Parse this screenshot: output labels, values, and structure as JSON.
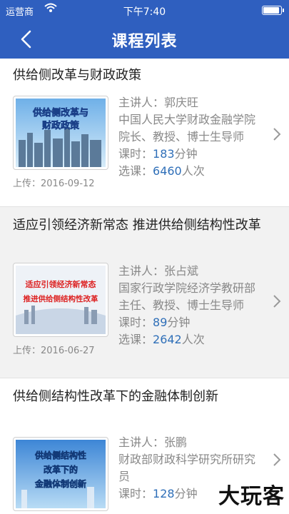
{
  "status_bar": {
    "carrier": "运营商",
    "time": "下午7:40"
  },
  "nav": {
    "title": "课程列表"
  },
  "courses": [
    {
      "title": "供给侧改革与财政政策",
      "thumb_lines": [
        "供给侧改革与",
        "财政政策"
      ],
      "upload": "上传：2016-09-12",
      "speaker_label": "主讲人：",
      "speaker": "郭庆旺",
      "bio": "中国人民大学财政金融学院院长、教授、博士生导师",
      "duration_label": "课时：",
      "duration": "183",
      "duration_unit": "分钟",
      "views_label": "选课：",
      "views": "6460",
      "views_unit": "人次"
    },
    {
      "title": "适应引领经济新常态 推进供给侧结构性改革",
      "thumb_lines": [
        "适应引领经济新常态",
        "推进供给侧结构性改革"
      ],
      "upload": "上传：2016-06-27",
      "speaker_label": "主讲人：",
      "speaker": "张占斌",
      "bio": "国家行政学院经济学教研部主任、教授、博士生导师",
      "duration_label": "课时：",
      "duration": "89",
      "duration_unit": "分钟",
      "views_label": "选课：",
      "views": "2642",
      "views_unit": "人次"
    },
    {
      "title": "供给侧结构性改革下的金融体制创新",
      "thumb_lines": [
        "供给侧结构性",
        "改革下的",
        "金融体制创新"
      ],
      "speaker_label": "主讲人：",
      "speaker": "张鹏",
      "bio": "财政部财政科学研究所研究员",
      "duration_label": "课时：",
      "duration": "128",
      "duration_unit": "分钟"
    }
  ],
  "watermark": "大玩客",
  "colors": {
    "nav": "#2f5fbf",
    "accent_number": "#2f6fb8",
    "muted": "#888888"
  }
}
